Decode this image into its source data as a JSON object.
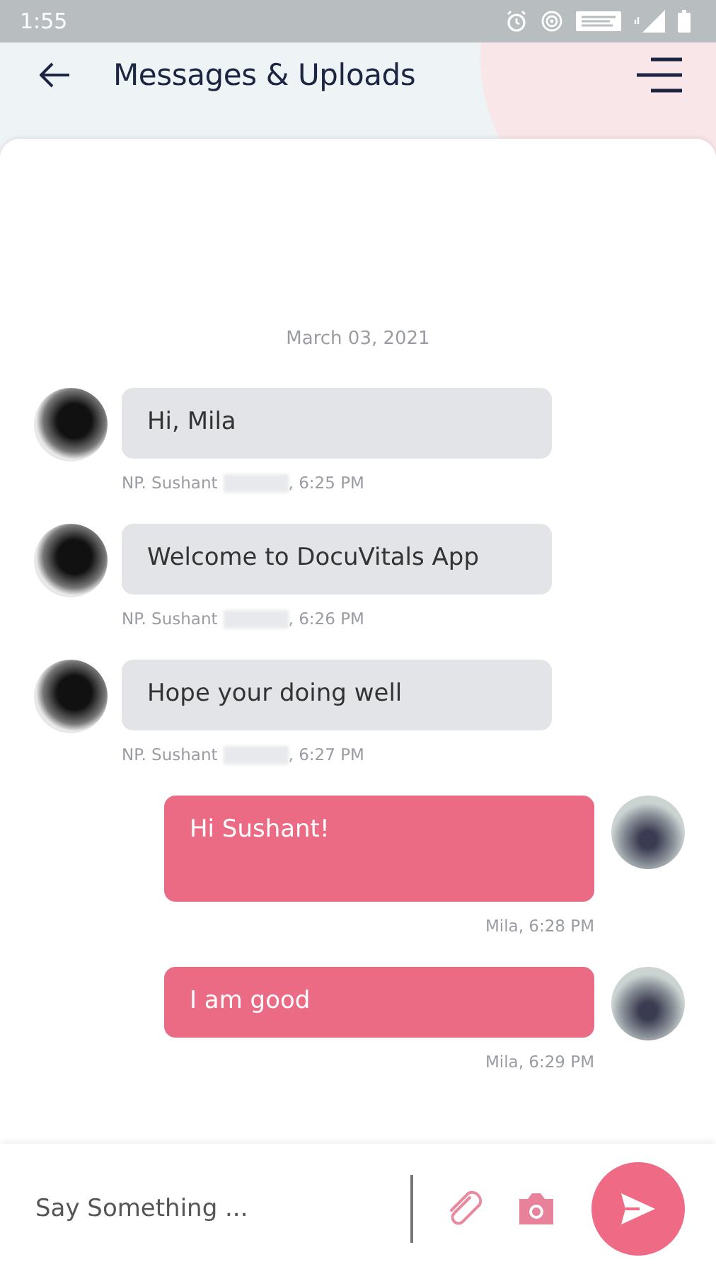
{
  "status_bar": {
    "time": "1:55"
  },
  "header": {
    "title": "Messages & Uploads"
  },
  "chat": {
    "date": "March 03, 2021",
    "messages": [
      {
        "kind": "incoming",
        "text": "Hi, Mila",
        "sender": "NP. Sushant",
        "redacted": true,
        "time": ", 6:25 PM"
      },
      {
        "kind": "incoming",
        "text": "Welcome to DocuVitals App",
        "sender": "NP. Sushant",
        "redacted": true,
        "time": ", 6:26 PM"
      },
      {
        "kind": "incoming",
        "text": "Hope your doing well",
        "sender": "NP. Sushant",
        "redacted": true,
        "time": ", 6:27 PM"
      },
      {
        "kind": "outgoing",
        "text": "Hi Sushant!",
        "sender": "Mila",
        "time": ", 6:28 PM",
        "tall": true
      },
      {
        "kind": "outgoing",
        "text": "I am good",
        "sender": "Mila",
        "time": ", 6:29 PM"
      }
    ]
  },
  "composer": {
    "placeholder": "Say Something ..."
  }
}
